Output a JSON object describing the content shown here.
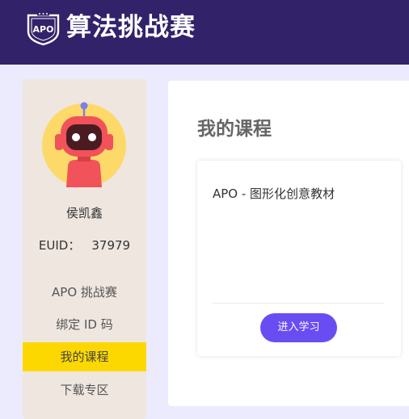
{
  "header": {
    "logo_text": "APO",
    "brand_title": "算法挑战赛",
    "colors": {
      "background": "#32226a",
      "text": "#ffffff"
    }
  },
  "sidebar": {
    "avatar_icon": "robot-avatar-icon",
    "user_name": "侯凯鑫",
    "euid_label": "EUID：",
    "euid_value": "37979",
    "nav_items": [
      {
        "label": "APO 挑战赛",
        "active": false
      },
      {
        "label": "绑定 ID 码",
        "active": false
      },
      {
        "label": "我的课程",
        "active": true
      },
      {
        "label": "下载专区",
        "active": false
      }
    ],
    "colors": {
      "background": "#efe6df",
      "active": "#fdd800"
    }
  },
  "main": {
    "title": "我的课程",
    "courses": [
      {
        "name": "APO - 图形化创意教材",
        "button_label": "进入学习"
      }
    ],
    "colors": {
      "button": "#6a4df2",
      "page_background": "#ecebfd"
    }
  }
}
